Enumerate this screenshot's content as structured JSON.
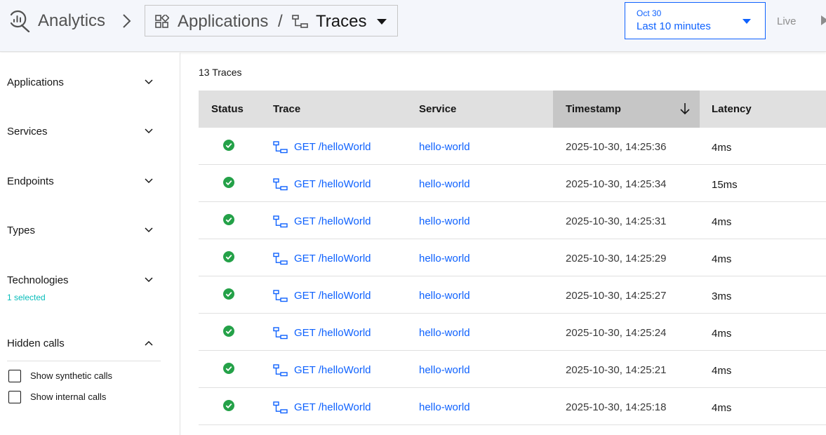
{
  "header": {
    "app_title": "Analytics",
    "scope": {
      "group": "Applications",
      "separator": "/",
      "current": "Traces"
    },
    "date_picker": {
      "day": "Oct 30",
      "range": "Last 10 minutes"
    },
    "live_label": "Live"
  },
  "sidebar": {
    "filters": [
      {
        "label": "Applications",
        "expanded": false,
        "sub": ""
      },
      {
        "label": "Services",
        "expanded": false,
        "sub": ""
      },
      {
        "label": "Endpoints",
        "expanded": false,
        "sub": ""
      },
      {
        "label": "Types",
        "expanded": false,
        "sub": ""
      },
      {
        "label": "Technologies",
        "expanded": false,
        "sub": "1 selected"
      },
      {
        "label": "Hidden calls",
        "expanded": true,
        "sub": ""
      }
    ],
    "checkboxes": [
      {
        "label": "Show synthetic calls",
        "checked": false
      },
      {
        "label": "Show internal calls",
        "checked": false
      }
    ]
  },
  "main": {
    "count_label": "13 Traces",
    "columns": [
      "Status",
      "Trace",
      "Service",
      "Timestamp",
      "Latency"
    ],
    "sorted_column": "Timestamp",
    "rows": [
      {
        "status": "ok",
        "trace": "GET /helloWorld",
        "service": "hello-world",
        "timestamp": "2025-10-30, 14:25:36",
        "latency": "4ms"
      },
      {
        "status": "ok",
        "trace": "GET /helloWorld",
        "service": "hello-world",
        "timestamp": "2025-10-30, 14:25:34",
        "latency": "15ms"
      },
      {
        "status": "ok",
        "trace": "GET /helloWorld",
        "service": "hello-world",
        "timestamp": "2025-10-30, 14:25:31",
        "latency": "4ms"
      },
      {
        "status": "ok",
        "trace": "GET /helloWorld",
        "service": "hello-world",
        "timestamp": "2025-10-30, 14:25:29",
        "latency": "4ms"
      },
      {
        "status": "ok",
        "trace": "GET /helloWorld",
        "service": "hello-world",
        "timestamp": "2025-10-30, 14:25:27",
        "latency": "3ms"
      },
      {
        "status": "ok",
        "trace": "GET /helloWorld",
        "service": "hello-world",
        "timestamp": "2025-10-30, 14:25:24",
        "latency": "4ms"
      },
      {
        "status": "ok",
        "trace": "GET /helloWorld",
        "service": "hello-world",
        "timestamp": "2025-10-30, 14:25:21",
        "latency": "4ms"
      },
      {
        "status": "ok",
        "trace": "GET /helloWorld",
        "service": "hello-world",
        "timestamp": "2025-10-30, 14:25:18",
        "latency": "4ms"
      }
    ]
  },
  "colors": {
    "accent": "#0f62fe",
    "success": "#24a148",
    "selected_count": "#08bdba"
  },
  "icons": {
    "header": [
      "analytics-icon",
      "breadcrumb-chevron-icon",
      "application-icon",
      "trace-icon",
      "caret-down-icon",
      "play-icon"
    ],
    "rows": [
      "checkmark-filled-icon",
      "trace-icon"
    ],
    "sort": "arrow-down-icon"
  }
}
